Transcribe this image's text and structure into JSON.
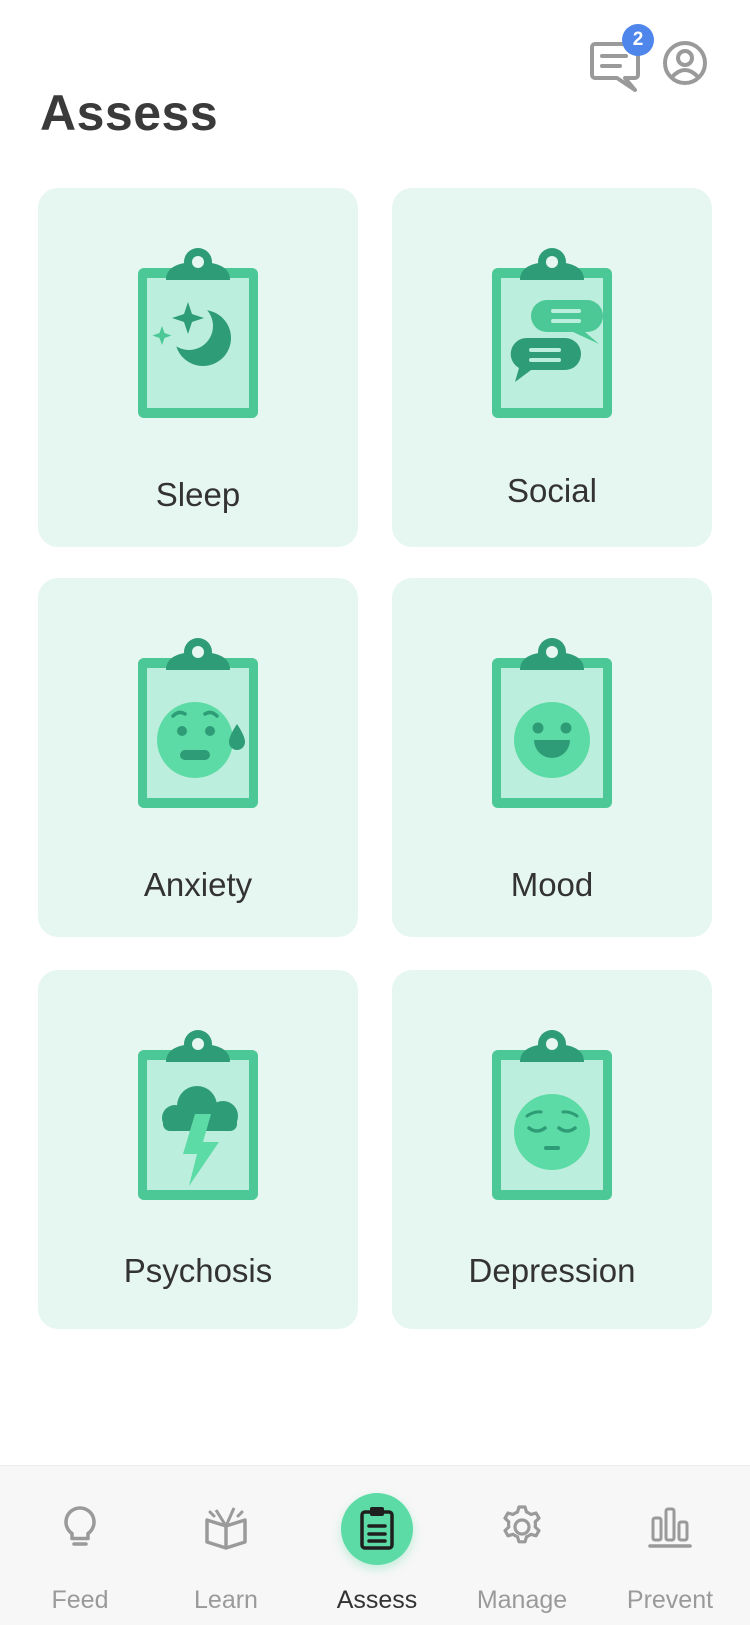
{
  "header": {
    "title": "Assess",
    "notification_count": "2",
    "icons": [
      "messages-icon",
      "profile-icon"
    ]
  },
  "cards": [
    {
      "label": "Sleep",
      "icon": "sleep-clipboard-icon"
    },
    {
      "label": "Social",
      "icon": "social-clipboard-icon"
    },
    {
      "label": "Anxiety",
      "icon": "anxiety-clipboard-icon"
    },
    {
      "label": "Mood",
      "icon": "mood-clipboard-icon"
    },
    {
      "label": "Psychosis",
      "icon": "psychosis-clipboard-icon"
    },
    {
      "label": "Depression",
      "icon": "depression-clipboard-icon"
    }
  ],
  "nav": {
    "items": [
      {
        "label": "Feed",
        "icon": "lightbulb-icon"
      },
      {
        "label": "Learn",
        "icon": "open-book-icon"
      },
      {
        "label": "Assess",
        "icon": "clipboard-icon",
        "active": true
      },
      {
        "label": "Manage",
        "icon": "gear-icon"
      },
      {
        "label": "Prevent",
        "icon": "bar-chart-icon"
      }
    ]
  },
  "colors": {
    "card_bg": "#e6f6f0",
    "clipboard_frame": "#4cc896",
    "clipboard_paper": "#bbeedc",
    "clip_dark": "#2e9c76",
    "accent": "#5ddba6",
    "badge": "#4f86ec"
  }
}
